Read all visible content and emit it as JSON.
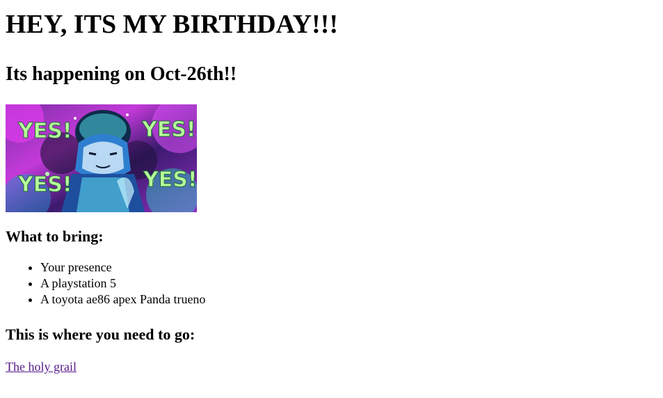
{
  "page": {
    "title": "HEY, ITS MY BIRTHDAY!!!",
    "subtitle": "Its happening on Oct-26th!!",
    "image": {
      "description_icon": "yes-gif-image",
      "overlay_texts": [
        "YES!",
        "YES!",
        "YES!",
        "YES!"
      ]
    },
    "bring_heading": "What to bring:",
    "bring_items": [
      "Your presence",
      "A playstation 5",
      "A toyota ae86 apex Panda trueno"
    ],
    "go_heading": "This is where you need to go:",
    "link_text": "The holy grail",
    "colors": {
      "link_visited": "#551a8b",
      "text": "#000000",
      "background": "#ffffff"
    }
  }
}
